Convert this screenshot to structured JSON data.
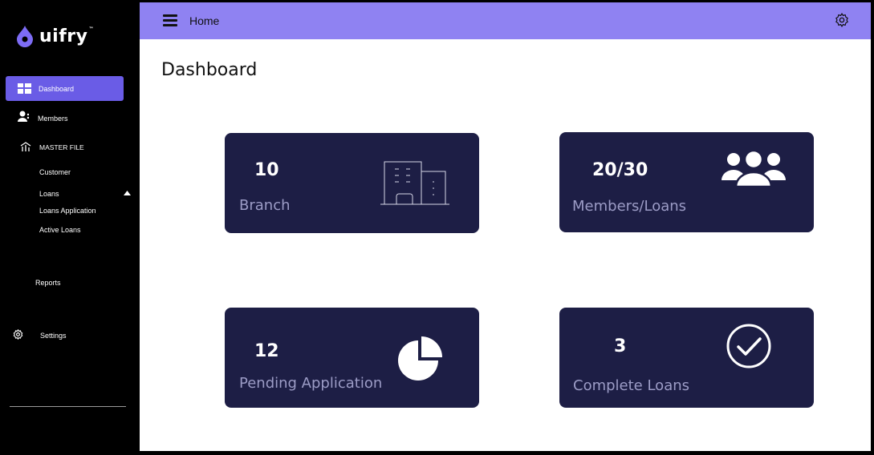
{
  "brand": {
    "name": "uifry",
    "tm": "™"
  },
  "sidebar": {
    "items": [
      {
        "label": "Dashboard",
        "icon": "grid-icon"
      },
      {
        "label": "Members",
        "icon": "members-icon"
      },
      {
        "label": "MASTER FILE",
        "icon": "chart-icon"
      },
      {
        "label": "Customer"
      },
      {
        "label": "Loans",
        "icon": "caret-up-icon"
      },
      {
        "label": "Loans Application"
      },
      {
        "label": "Active Loans"
      },
      {
        "label": "Reports"
      },
      {
        "label": "Settings",
        "icon": "gear-icon"
      }
    ]
  },
  "topbar": {
    "title": "Home"
  },
  "page": {
    "title": "Dashboard"
  },
  "cards": [
    {
      "value": "10",
      "label": "Branch",
      "icon": "building-icon"
    },
    {
      "value": "20/30",
      "label": "Members/Loans",
      "icon": "group-icon"
    },
    {
      "value": "12",
      "label": "Pending Application",
      "icon": "pie-chart-icon"
    },
    {
      "value": "3",
      "label": "Complete Loans",
      "icon": "check-circle-icon"
    }
  ],
  "colors": {
    "accent": "#8f82f2",
    "active": "#6a5ce6",
    "card": "#1d1e45",
    "label": "#9c9cc6"
  }
}
